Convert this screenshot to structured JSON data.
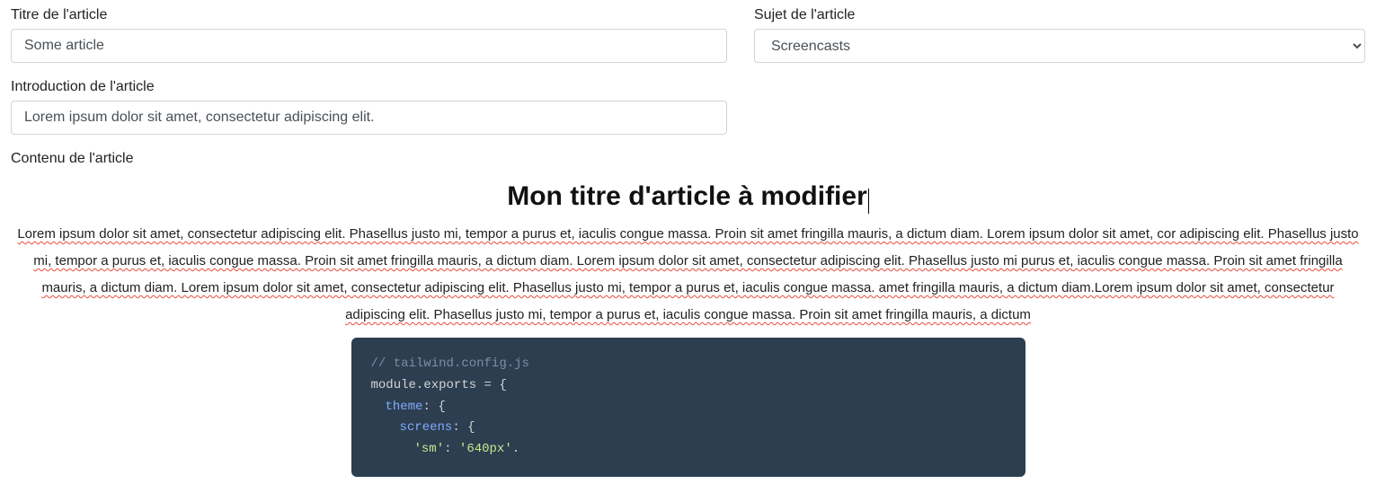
{
  "form": {
    "title_label": "Titre de l'article",
    "title_value": "Some article",
    "subject_label": "Sujet de l'article",
    "subject_value": "Screencasts",
    "intro_label": "Introduction de l'article",
    "intro_value": "Lorem ipsum dolor sit amet, consectetur adipiscing elit.",
    "content_label": "Contenu de l'article"
  },
  "article": {
    "heading": "Mon titre d'article à modifier",
    "body": "Lorem ipsum dolor sit amet, consectetur adipiscing elit. Phasellus justo mi, tempor a purus et, iaculis congue massa. Proin sit amet fringilla mauris, a dictum diam. Lorem ipsum dolor sit amet, cor adipiscing elit. Phasellus justo mi, tempor a purus et, iaculis congue massa. Proin sit amet fringilla mauris, a dictum diam. Lorem ipsum dolor sit amet, consectetur adipiscing elit. Phasellus justo mi purus et, iaculis congue massa. Proin sit amet fringilla mauris, a dictum diam. Lorem ipsum dolor sit amet, consectetur adipiscing elit. Phasellus justo mi, tempor a purus et, iaculis congue massa. amet fringilla mauris, a dictum diam.Lorem ipsum dolor sit amet, consectetur adipiscing elit. Phasellus justo mi, tempor a purus et, iaculis congue massa. Proin sit amet fringilla mauris, a dictum"
  },
  "code": {
    "line1_comment": "// tailwind.config.js",
    "line2a": "module",
    "line2b": ".exports ",
    "line2c": "= {",
    "line3a": "theme",
    "line3b": ": {",
    "line4a": "screens",
    "line4b": ": {",
    "line5a": "'sm'",
    "line5b": ": ",
    "line5c": "'640px'",
    "line5d": "."
  }
}
